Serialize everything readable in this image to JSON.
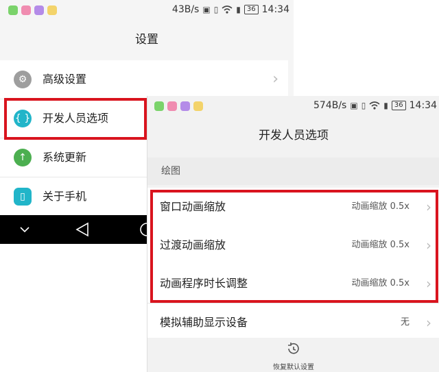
{
  "back": {
    "status": {
      "speed": "43B/s",
      "time": "14:34",
      "battery": "36"
    },
    "title": "设置",
    "items": [
      {
        "label": "高级设置",
        "icon": "gear-icon",
        "color": "#9e9e9e"
      },
      {
        "label": "开发人员选项",
        "icon": "braces-icon",
        "color": "#21b5c9"
      },
      {
        "label": "系统更新",
        "icon": "arrow-up-icon",
        "color": "#4caf50"
      },
      {
        "label": "关于手机",
        "icon": "phone-icon",
        "color": "#21b5c9"
      }
    ]
  },
  "front": {
    "status": {
      "speed": "574B/s",
      "time": "14:34",
      "battery": "36"
    },
    "title": "开发人员选项",
    "section": "绘图",
    "rows": [
      {
        "label": "窗口动画缩放",
        "value": "动画缩放 0.5x"
      },
      {
        "label": "过渡动画缩放",
        "value": "动画缩放 0.5x"
      },
      {
        "label": "动画程序时长调整",
        "value": "动画缩放 0.5x"
      },
      {
        "label": "模拟辅助显示设备",
        "value": "无"
      }
    ],
    "restore_label": "恢复默认设置"
  },
  "status_glyphs": {
    "nfc": "NFC",
    "vibrate": "▯",
    "wifi": "wifi"
  },
  "accent": "#d9141e"
}
